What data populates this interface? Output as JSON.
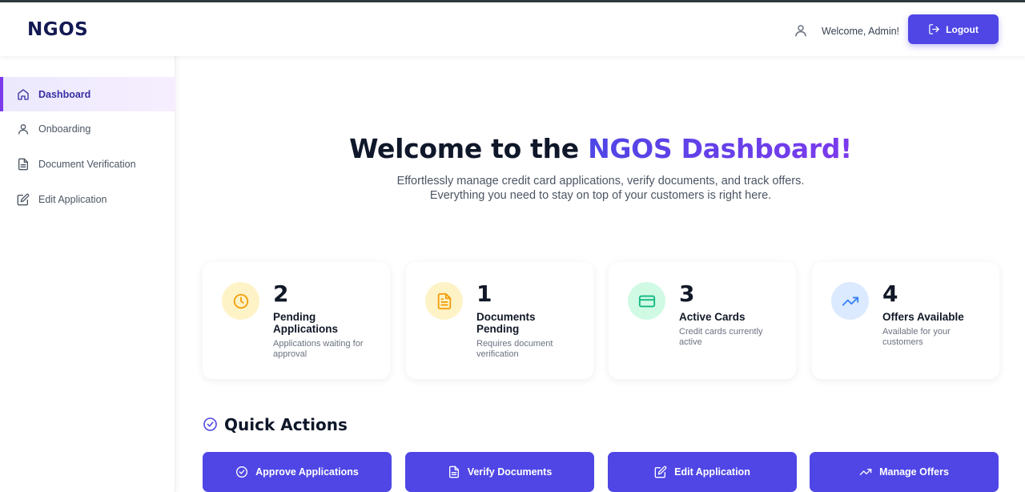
{
  "header": {
    "brand": "NGOS",
    "welcome_text": "Welcome, Admin!",
    "logout_label": "Logout",
    "user_icon": "user-icon",
    "logout_icon": "logout-icon"
  },
  "sidebar": {
    "items": [
      {
        "label": "Dashboard",
        "icon": "home-icon",
        "active": true
      },
      {
        "label": "Onboarding",
        "icon": "user-icon",
        "active": false
      },
      {
        "label": "Document Verification",
        "icon": "document-icon",
        "active": false
      },
      {
        "label": "Edit Application",
        "icon": "edit-icon",
        "active": false
      }
    ]
  },
  "hero": {
    "title_prefix": "Welcome to the ",
    "title_accent": "NGOS Dashboard!",
    "subtitle_line1": "Effortlessly manage credit card applications, verify documents, and track offers.",
    "subtitle_line2": "Everything you need to stay on top of your customers is right here."
  },
  "stats": [
    {
      "value": "2",
      "label": "Pending Applications",
      "description": "Applications waiting for approval",
      "icon": "clock-icon",
      "icon_color": "#f59e0b",
      "icon_bg": "#fef3c7"
    },
    {
      "value": "1",
      "label": "Documents Pending",
      "description": "Requires document verification",
      "icon": "file-icon",
      "icon_color": "#f59e0b",
      "icon_bg": "#fef3c7"
    },
    {
      "value": "3",
      "label": "Active Cards",
      "description": "Credit cards currently active",
      "icon": "credit-card-icon",
      "icon_color": "#10b981",
      "icon_bg": "#d1fae5"
    },
    {
      "value": "4",
      "label": "Offers Available",
      "description": "Available for your customers",
      "icon": "trending-up-icon",
      "icon_color": "#3b82f6",
      "icon_bg": "#dbeafe"
    }
  ],
  "quick_actions": {
    "title": "Quick Actions",
    "icon": "check-circle-icon",
    "buttons": [
      {
        "label": "Approve Applications",
        "icon": "check-circle-icon"
      },
      {
        "label": "Verify Documents",
        "icon": "file-icon"
      },
      {
        "label": "Edit Application",
        "icon": "edit-icon"
      },
      {
        "label": "Manage Offers",
        "icon": "trending-up-icon"
      }
    ]
  },
  "colors": {
    "primary": "#4f46e5",
    "accent": "#7c3aed",
    "brand_text": "#141a53"
  }
}
